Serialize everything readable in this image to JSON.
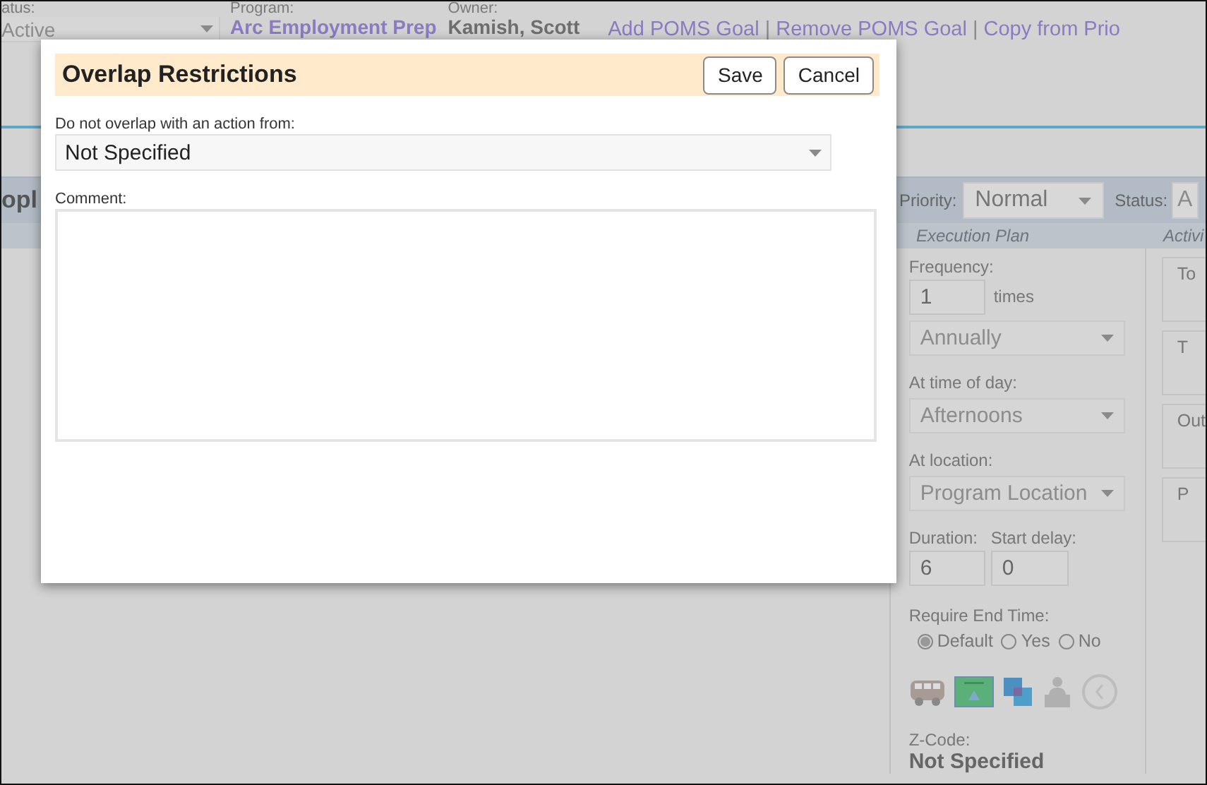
{
  "header": {
    "status": {
      "label": "atus:",
      "value": "Active"
    },
    "program": {
      "label": "Program:",
      "value": "Arc Employment Prep"
    },
    "owner": {
      "label": "Owner:",
      "value": "Kamish, Scott"
    },
    "links": [
      "Add POMS Goal",
      "Remove POMS Goal",
      "Copy from Prio"
    ],
    "link_separator": "|"
  },
  "title_bar": {
    "title": "opl",
    "priority": {
      "label": "Priority:",
      "value": "Normal"
    },
    "status": {
      "label": "Status:",
      "value": "A"
    }
  },
  "columns": [
    "Execution Plan",
    "Activi"
  ],
  "execution_plan": {
    "frequency": {
      "label": "Frequency:",
      "value": "1",
      "unit": "times",
      "period": "Annually"
    },
    "time_of_day": {
      "label": "At time of day:",
      "value": "Afternoons"
    },
    "location": {
      "label": "At location:",
      "value": "Program Location"
    },
    "duration": {
      "label": "Duration:",
      "value": "6"
    },
    "start_delay": {
      "label": "Start delay:",
      "value": "0"
    },
    "require_end_time": {
      "label": "Require End Time:",
      "options": [
        {
          "label": "Default",
          "selected": true
        },
        {
          "label": "Yes",
          "selected": false
        },
        {
          "label": "No",
          "selected": false
        }
      ]
    },
    "zcode": {
      "label": "Z-Code:",
      "value": "Not Specified"
    }
  },
  "activity_cards": [
    "To",
    "T",
    "Out",
    "P"
  ],
  "dialog": {
    "title": "Overlap Restrictions",
    "buttons": [
      "Save",
      "Cancel"
    ],
    "overlap": {
      "label": "Do not overlap with an action from:",
      "value": "Not Specified"
    },
    "comment": {
      "label": "Comment:"
    }
  }
}
